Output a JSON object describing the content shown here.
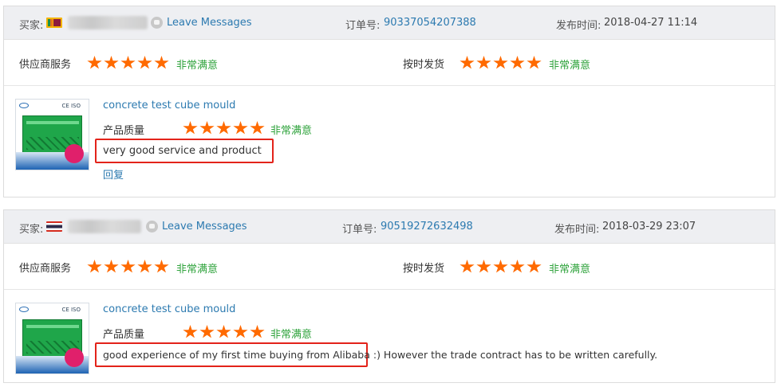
{
  "labels": {
    "buyer": "买家:",
    "leave_messages": "Leave Messages",
    "order_no": "订单号:",
    "published": "发布时间:",
    "supplier_service": "供应商服务",
    "on_time_delivery": "按时发货",
    "product_quality": "产品质量",
    "very_satisfied": "非常满意",
    "reply": "回复"
  },
  "colors": {
    "star": "#ff6a00",
    "link": "#2c7ab0",
    "satisfied": "#2fa33c",
    "highlight": "#e3231a",
    "header_bg": "#eeeff2"
  },
  "reviews": [
    {
      "flag": "sri-lanka-flag-icon",
      "order_no": "90337054207388",
      "published_at": "2018-04-27 11:14",
      "supplier_service_stars": 5,
      "on_time_delivery_stars": 5,
      "product_name": "concrete test cube mould",
      "product_quality_stars": 5,
      "comment": "very good service and product",
      "comment_extra": "",
      "has_reply_link": true
    },
    {
      "flag": "thailand-flag-icon",
      "order_no": "90519272632498",
      "published_at": "2018-03-29 23:07",
      "supplier_service_stars": 5,
      "on_time_delivery_stars": 5,
      "product_name": "concrete test cube mould",
      "product_quality_stars": 5,
      "comment": "good experience of my first time buying from Alibaba :)",
      "comment_extra": " However the trade contract has to be written carefully.",
      "has_reply_link": false
    }
  ]
}
